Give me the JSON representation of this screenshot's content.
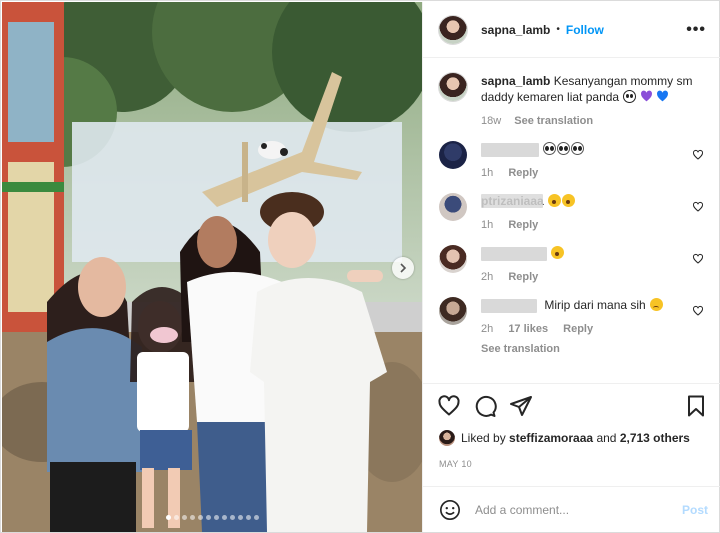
{
  "post": {
    "username": "sapna_lamb",
    "separator": "•",
    "follow_label": "Follow",
    "more_label": "•••",
    "carousel_total": 12,
    "carousel_active": 1
  },
  "caption": {
    "username": "sapna_lamb",
    "text": "Kesanyangan mommy sm daddy kemaren liat panda",
    "emojis": [
      "panda-emoji",
      "purple-heart-emoji",
      "blue-heart-emoji"
    ],
    "age": "18w",
    "see_translation": "See translation"
  },
  "comments": [
    {
      "username_hidden": true,
      "text": "",
      "emojis": [
        "eyes-emoji",
        "eyes-emoji",
        "eyes-emoji"
      ],
      "age": "1h",
      "reply": "Reply"
    },
    {
      "username": "ptrizaniaaa",
      "text": "",
      "emojis": [
        "open-mouth-emoji",
        "open-mouth-emoji"
      ],
      "age": "1h",
      "reply": "Reply"
    },
    {
      "username_hidden": true,
      "text": "",
      "emojis": [
        "open-mouth-emoji"
      ],
      "age": "2h",
      "reply": "Reply"
    },
    {
      "username_hidden": true,
      "text": "Mirip dari mana sih",
      "emojis": [
        "sad-face-emoji"
      ],
      "age": "2h",
      "likes": "17 likes",
      "reply": "Reply",
      "see_translation": "See translation"
    }
  ],
  "likes": {
    "prefix": "Liked by",
    "user": "steffizamoraaa",
    "and": "and",
    "count": "2,713 others"
  },
  "date": "MAY 10",
  "add_comment": {
    "placeholder": "Add a comment...",
    "post_label": "Post"
  },
  "colors": {
    "accent": "#0095f6",
    "muted": "#8e8e8e",
    "text": "#262626",
    "post_disabled": "#b3dbff",
    "heart_purple": "#8a4fd8",
    "heart_blue": "#1877f2"
  }
}
